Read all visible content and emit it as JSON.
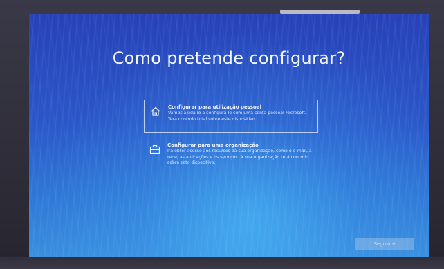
{
  "screen": {
    "title": "Como pretende configurar?",
    "options": [
      {
        "title": "Configurar para utilização pessoal",
        "description": "Vamos ajudá-lo a configurá-lo com uma conta pessoal Microsoft. Terá controlo total sobre este dispositivo.",
        "icon": "home-icon",
        "selected": true
      },
      {
        "title": "Configurar para uma organização",
        "description": "Irá obter acesso aos recursos da sua organização, como o e-mail, a rede, as aplicações e os serviços. A sua organização terá controlo sobre este dispositivo.",
        "icon": "briefcase-icon",
        "selected": false
      }
    ],
    "next_label": "Seguinte"
  },
  "colors": {
    "background_top": "#2741b8",
    "background_bottom": "#3a8fdf",
    "text": "#f2f6ff"
  }
}
